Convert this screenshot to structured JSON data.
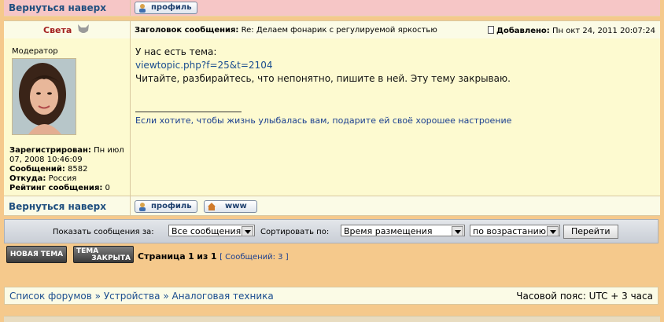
{
  "nav": {
    "back_to_top": "Вернуться наверх"
  },
  "buttons": {
    "profile": "профиль",
    "www": "www"
  },
  "post": {
    "author": "Света",
    "subject_label": "Заголовок сообщения:",
    "subject": "Re: Делаем фонарик с регулируемой яркостью",
    "added_label": "Добавлено:",
    "added": "Пн окт 24, 2011 20:07:24",
    "rank": "Модератор",
    "registered_label": "Зарегистрирован:",
    "registered_line1": "Пн июл",
    "registered_line2": "07, 2008 10:46:09",
    "posts_label": "Сообщений:",
    "posts": "8582",
    "from_label": "Откуда:",
    "from": "Россия",
    "rating_label": "Рейтинг сообщения:",
    "rating": "0",
    "body_line1": "У нас есть тема:",
    "body_link": "viewtopic.php?f=25&t=2104",
    "body_line3": "Читайте, разбирайтесь, что непонятно, пишите в ней. Эту тему закрываю.",
    "signature": "Если хотите, чтобы жизнь улыбалась вам, подарите ей своё хорошее настроение"
  },
  "sortbar": {
    "show_label": "Показать сообщения за:",
    "show_value": "Все сообщения",
    "sort_label": "Сортировать по:",
    "sort_value": "Время размещения",
    "order_value": "по возрастанию",
    "go_label": "Перейти"
  },
  "actions": {
    "new_topic": "НОВАЯ ТЕМА",
    "closed_line1": "ТЕМА",
    "closed_line2": "ЗАКРЫТА"
  },
  "pager": {
    "page_word": "Страница",
    "page": "1",
    "of_word": "из",
    "total": "1",
    "count": "[ Сообщений: 3 ]"
  },
  "breadcrumb": {
    "item1": "Список форумов",
    "sep": "»",
    "item2": "Устройства",
    "item3": "Аналоговая техника"
  },
  "timezone": "Часовой пояс: UTC + 3 часа",
  "colors": {
    "accent": "#1a4d8f",
    "author": "#a32020",
    "page_bg": "#f5c98c",
    "post_bg": "#fdfad0"
  }
}
